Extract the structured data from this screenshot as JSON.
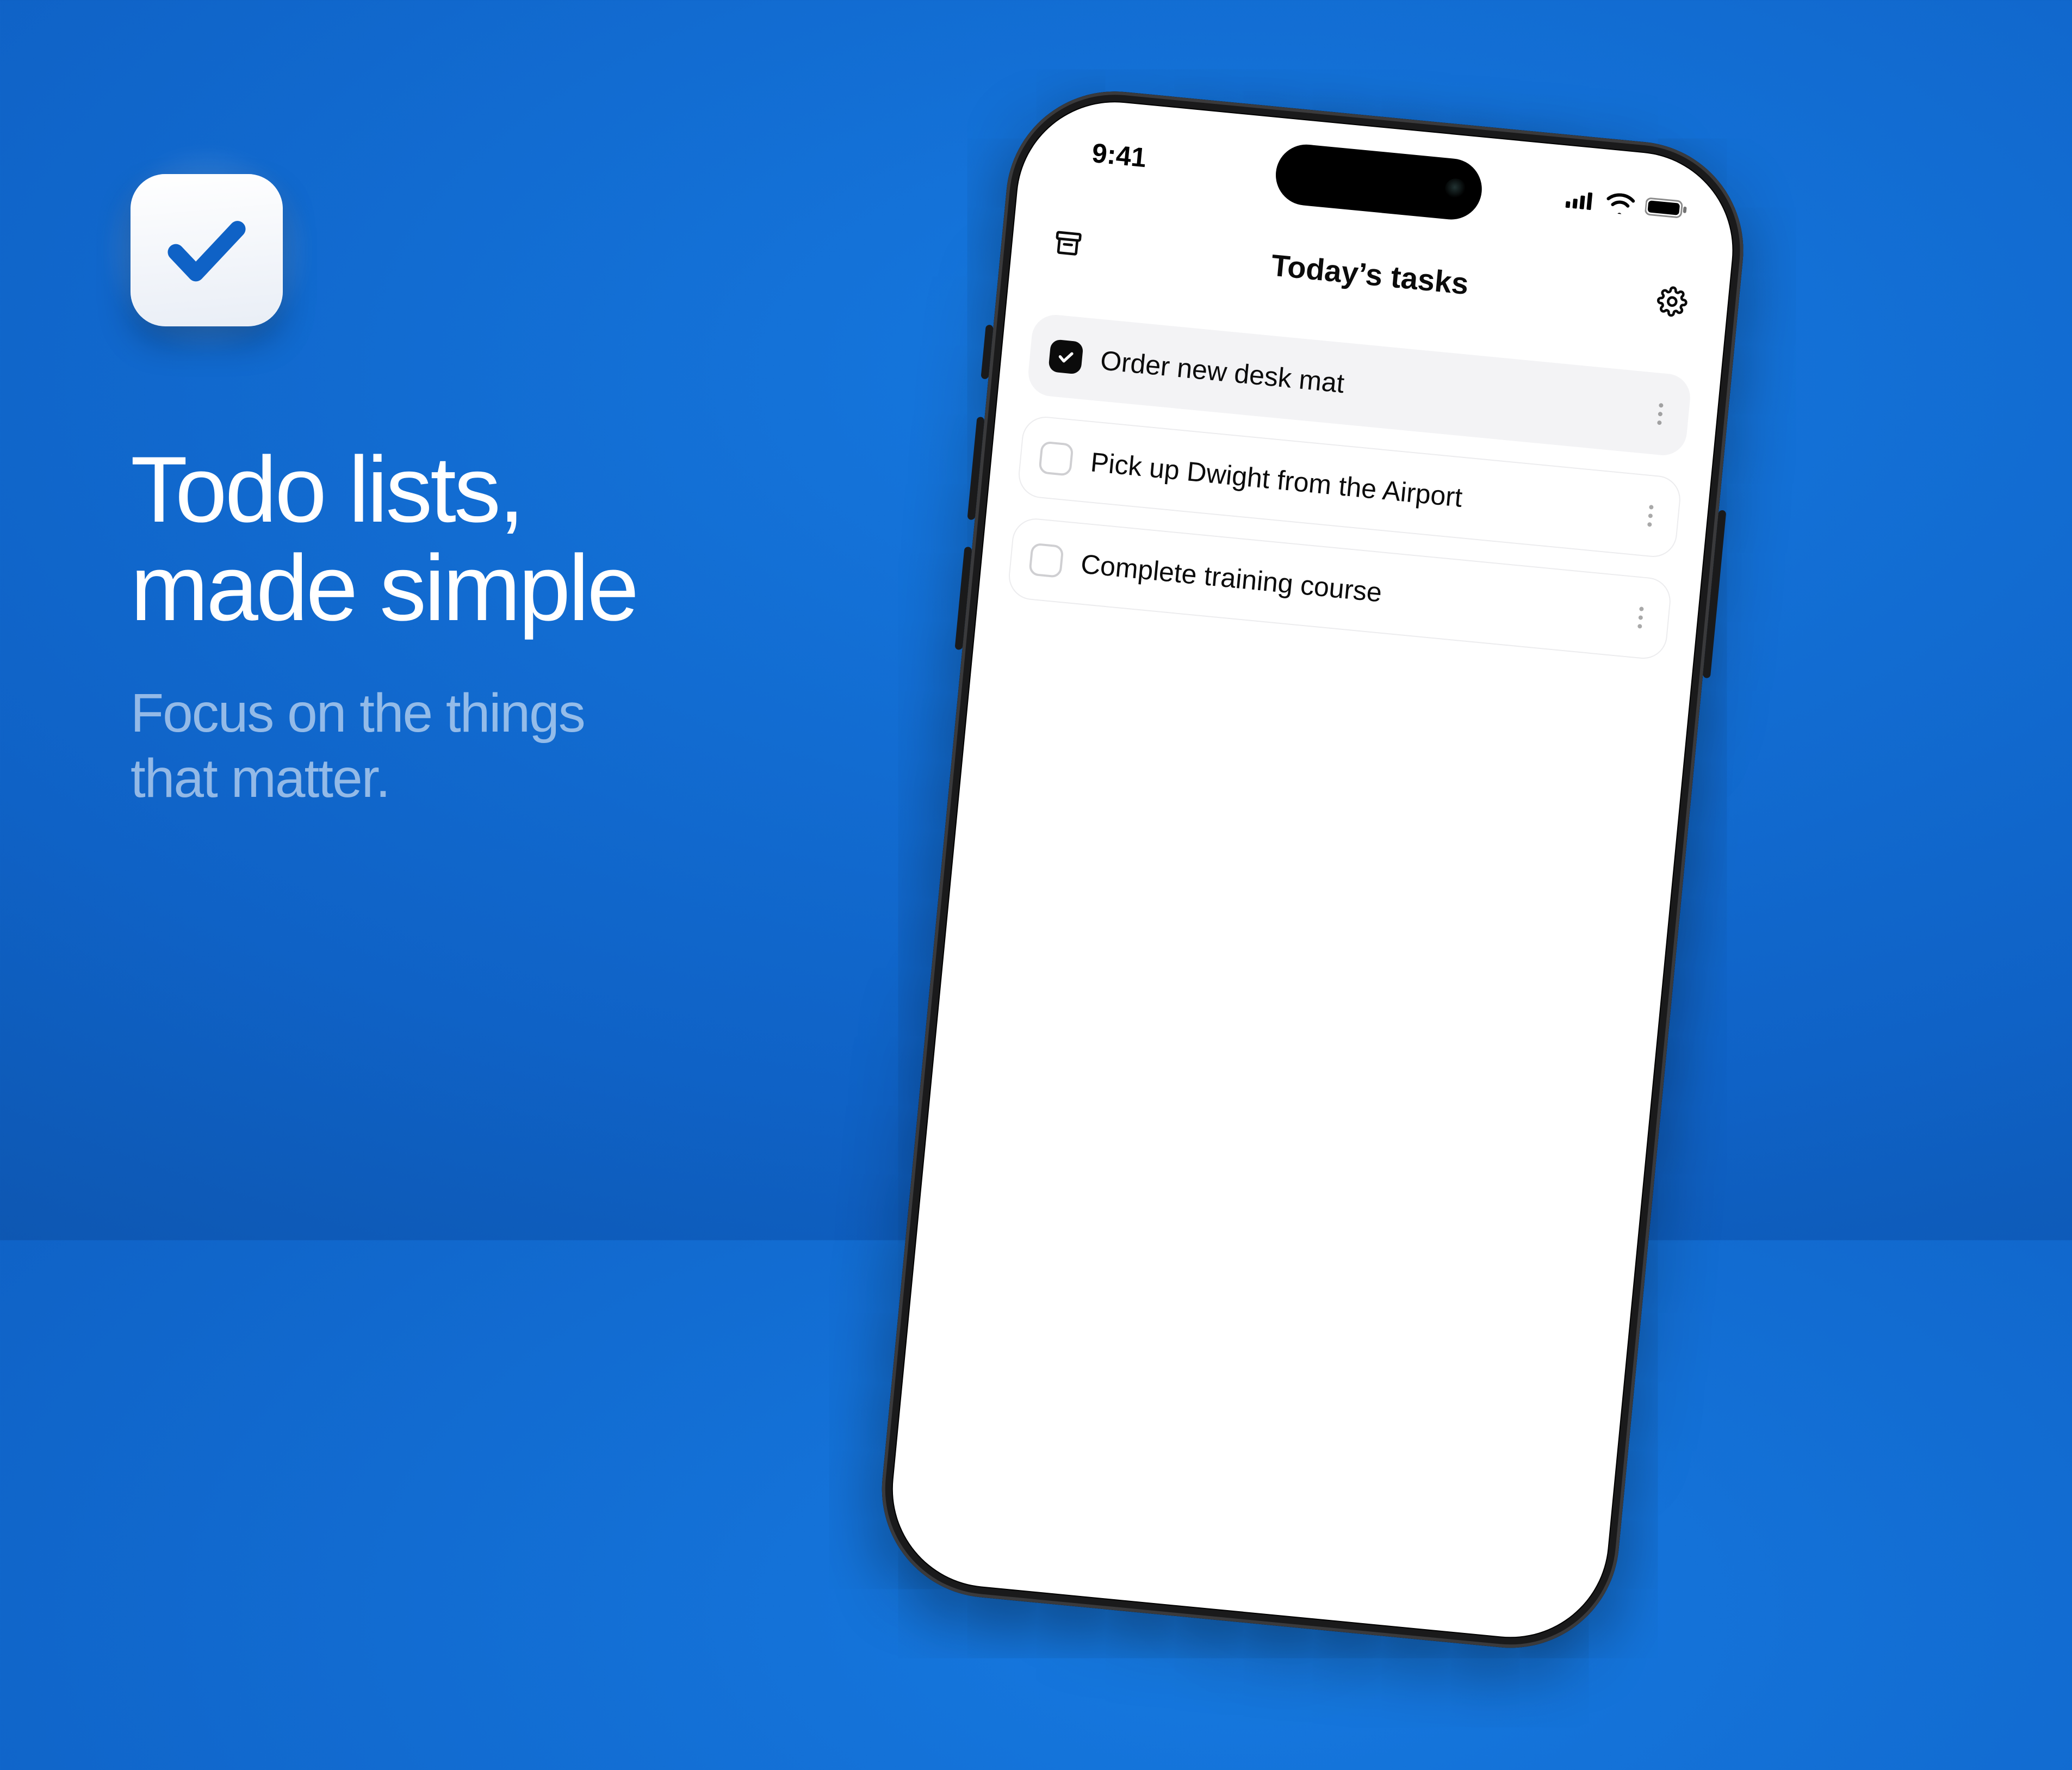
{
  "marketing": {
    "headline_line1": "Todo lists,",
    "headline_line2": "made simple",
    "subhead_line1": "Focus on the things",
    "subhead_line2": "that matter."
  },
  "phone": {
    "status": {
      "time": "9:41"
    },
    "header": {
      "title": "Today’s tasks"
    },
    "tasks": [
      {
        "label": "Order new desk mat",
        "done": true
      },
      {
        "label": "Pick up Dwight from the Airport",
        "done": false
      },
      {
        "label": "Complete training course",
        "done": false
      }
    ]
  }
}
